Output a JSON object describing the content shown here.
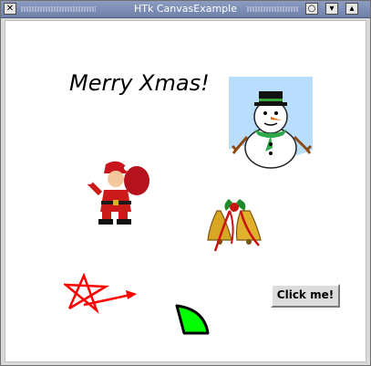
{
  "window": {
    "title": "HTk CanvasExample",
    "close_icon": "close-icon",
    "titlebar_buttons": [
      "circle-icon",
      "minimize-icon",
      "maximize-icon"
    ]
  },
  "canvas": {
    "greeting": "Merry Xmas!",
    "button_label": "Click me!",
    "images": [
      "snowman",
      "santa-claus",
      "christmas-bells"
    ],
    "shapes": [
      "red-star-arrow",
      "green-pie-wedge"
    ],
    "colors": {
      "star": "#ff0000",
      "wedge_fill": "#00ff00",
      "wedge_outline": "#000000",
      "snowman_sky": "#b7dcff"
    }
  }
}
